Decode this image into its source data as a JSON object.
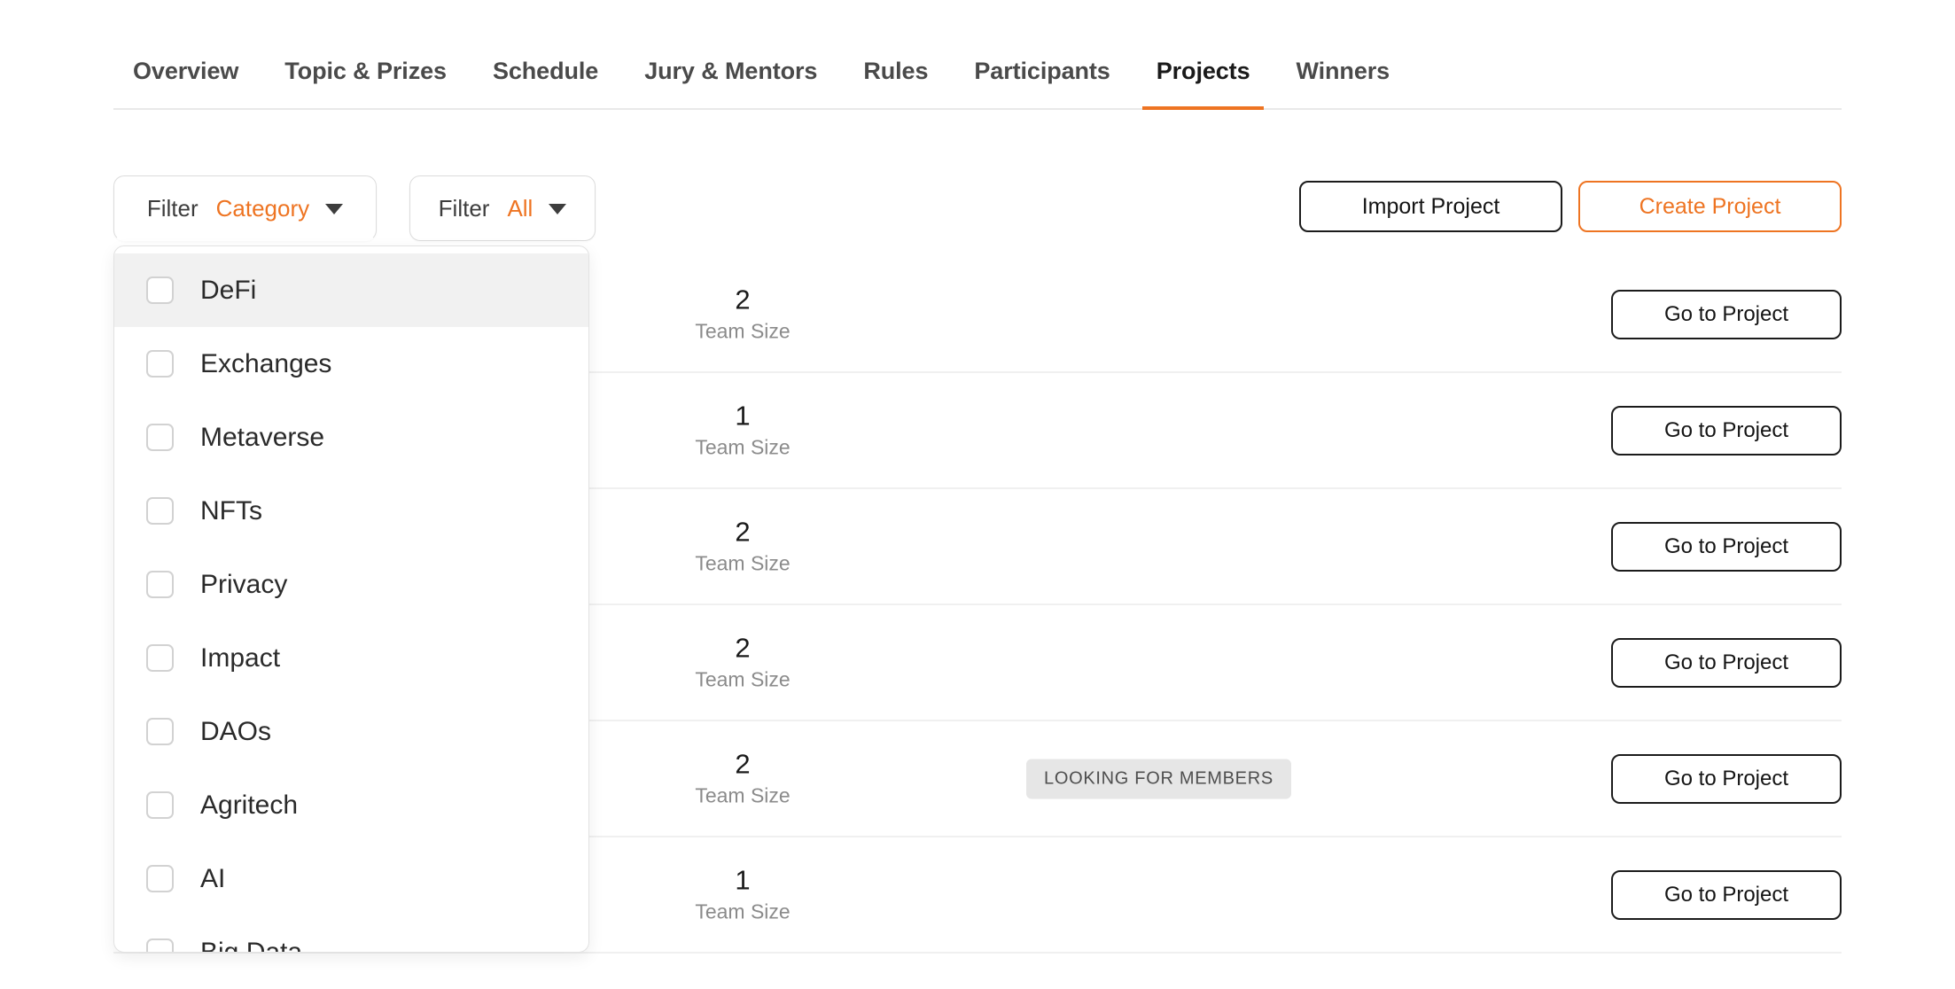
{
  "nav": {
    "tabs": [
      {
        "label": "Overview",
        "active": false
      },
      {
        "label": "Topic & Prizes",
        "active": false
      },
      {
        "label": "Schedule",
        "active": false
      },
      {
        "label": "Jury & Mentors",
        "active": false
      },
      {
        "label": "Rules",
        "active": false
      },
      {
        "label": "Participants",
        "active": false
      },
      {
        "label": "Projects",
        "active": true
      },
      {
        "label": "Winners",
        "active": false
      }
    ],
    "active_tab": "Projects",
    "active_underline_color": "#ee7422"
  },
  "toolbar": {
    "filter_category": {
      "prefix": "Filter",
      "value": "Category",
      "caret": "chevron-down-icon"
    },
    "filter_all": {
      "prefix": "Filter",
      "value": "All",
      "caret": "chevron-down-icon"
    },
    "import_project_label": "Import Project",
    "create_project_label": "Create Project",
    "accent_color": "#ee7422"
  },
  "category_dropdown": {
    "open": true,
    "hovered_item": "DeFi",
    "items": [
      {
        "label": "DeFi",
        "checked": false,
        "hovered": true
      },
      {
        "label": "Exchanges",
        "checked": false,
        "hovered": false
      },
      {
        "label": "Metaverse",
        "checked": false,
        "hovered": false
      },
      {
        "label": "NFTs",
        "checked": false,
        "hovered": false
      },
      {
        "label": "Privacy",
        "checked": false,
        "hovered": false
      },
      {
        "label": "Impact",
        "checked": false,
        "hovered": false
      },
      {
        "label": "DAOs",
        "checked": false,
        "hovered": false
      },
      {
        "label": "Agritech",
        "checked": false,
        "hovered": false
      },
      {
        "label": "AI",
        "checked": false,
        "hovered": false
      },
      {
        "label": "Big Data",
        "checked": false,
        "hovered": false
      }
    ]
  },
  "projects": {
    "team_size_label": "Team Size",
    "goto_label": "Go to Project",
    "rows": [
      {
        "team_size": "2",
        "badge": "",
        "goto": "Go to Project"
      },
      {
        "team_size": "1",
        "badge": "",
        "goto": "Go to Project"
      },
      {
        "team_size": "2",
        "badge": "",
        "goto": "Go to Project"
      },
      {
        "team_size": "2",
        "badge": "",
        "goto": "Go to Project"
      },
      {
        "team_size": "2",
        "badge": "LOOKING FOR MEMBERS",
        "goto": "Go to Project"
      },
      {
        "team_size": "1",
        "badge": "",
        "goto": "Go to Project"
      }
    ]
  }
}
